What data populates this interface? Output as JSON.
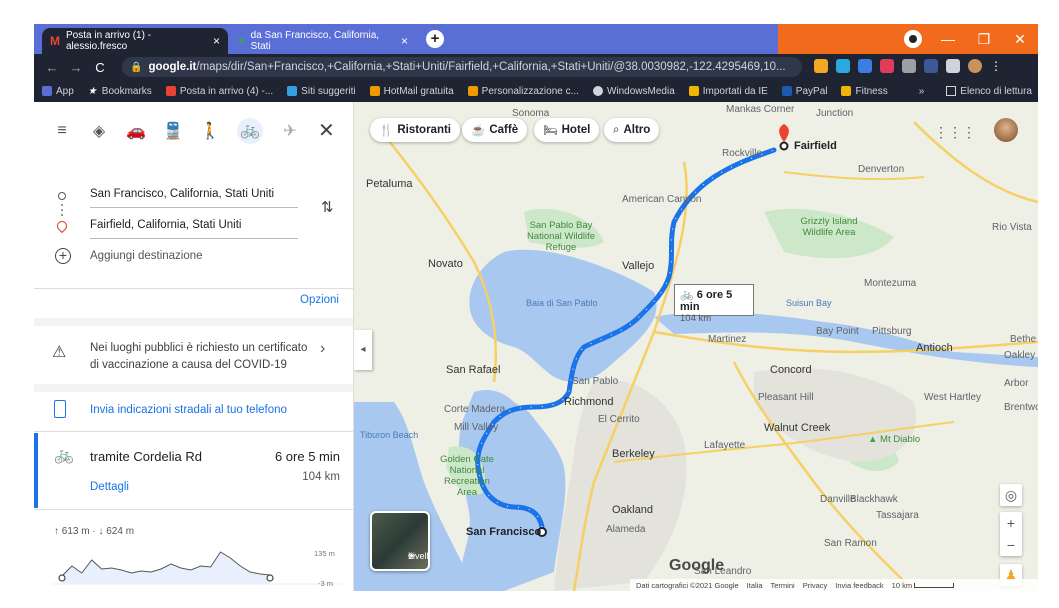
{
  "browser": {
    "tabs": [
      {
        "title": "Posta in arrivo (1) - alessio.fresco",
        "icon": "gmail-icon"
      },
      {
        "title": "da San Francisco, California, Stati",
        "icon": "maps-icon"
      }
    ],
    "tab_close": "×",
    "new_tab": "+",
    "window_controls": {
      "minimize": "—",
      "restore": "❐",
      "close": "✕"
    },
    "url_domain": "google.it",
    "url_path": "/maps/dir/San+Francisco,+California,+Stati+Uniti/Fairfield,+California,+Stati+Uniti/@38.0030982,-122.4295469,10...",
    "nav": {
      "back": "←",
      "forward": "→",
      "reload": "C"
    }
  },
  "bookmarks": {
    "items": [
      {
        "label": "App",
        "color": "#5a6fd6"
      },
      {
        "label": "Bookmarks",
        "color": "#ffffff"
      },
      {
        "label": "Posta in arrivo (4) -...",
        "color": "#ea4335"
      },
      {
        "label": "Siti suggeriti",
        "color": "#34a0e0"
      },
      {
        "label": "HotMail gratuita",
        "color": "#f29900"
      },
      {
        "label": "Personalizzazione c...",
        "color": "#f29900"
      },
      {
        "label": "WindowsMedia",
        "color": "#cfd3dc"
      },
      {
        "label": "Importati da IE",
        "color": "#f2b600"
      },
      {
        "label": "PayPal",
        "color": "#1a5ab0"
      },
      {
        "label": "Fitness",
        "color": "#f2b600"
      }
    ],
    "more": "»",
    "reading_list": "Elenco di lettura"
  },
  "panel": {
    "origin": "San Francisco, California, Stati Uniti",
    "destination": "Fairfield, California, Stati Uniti",
    "add_destination": "Aggiungi destinazione",
    "options": "Opzioni",
    "covid_notice": "Nei luoghi pubblici è richiesto un certificato di vaccinazione a causa del COVID-19",
    "send_to_phone": "Invia indicazioni stradali al tuo telefono",
    "route": {
      "via": "tramite Cordelia Rd",
      "duration": "6 ore 5 min",
      "distance": "104 km",
      "details": "Dettagli"
    },
    "elevation": {
      "summary": "↑ 613 m · ↓ 624 m",
      "max_label": "135 m",
      "min_label": "-3 m",
      "profile": [
        2,
        12,
        5,
        18,
        9,
        10,
        8,
        5,
        7,
        6,
        9,
        14,
        10,
        8,
        12,
        11,
        26,
        20,
        12,
        6,
        4,
        3
      ]
    }
  },
  "map": {
    "chips": [
      {
        "icon": "🍴",
        "label": "Ristoranti"
      },
      {
        "icon": "☕",
        "label": "Caffè"
      },
      {
        "icon": "🛏",
        "label": "Hotel"
      },
      {
        "icon": "⌕",
        "label": "Altro"
      }
    ],
    "route_box": {
      "time": "6 ore 5 min",
      "distance": "104 km"
    },
    "start_label": "San Francisco",
    "end_label": "Fairfield",
    "layers": "Livelli",
    "google_logo": "Google",
    "attribution": [
      "Dati cartografici ©2021 Google",
      "Italia",
      "Termini",
      "Privacy",
      "Invia feedback",
      "10 km"
    ],
    "cities": {
      "petaluma": "Petaluma",
      "novato": "Novato",
      "vallejo": "Vallejo",
      "american_canyon": "American Canyon",
      "san_rafael": "San Rafael",
      "corte_madera": "Corte Madera",
      "mill_valley": "Mill Valley",
      "richmond": "Richmond",
      "san_pablo": "San Pablo",
      "el_cerrito": "El Cerrito",
      "berkeley": "Berkeley",
      "oakland": "Oakland",
      "alameda": "Alameda",
      "san_leandro": "San Leandro",
      "concord": "Concord",
      "martinez": "Martinez",
      "walnut_creek": "Walnut Creek",
      "lafayette": "Lafayette",
      "danville": "Danville",
      "pleasant_hill": "Pleasant Hill",
      "antioch": "Antioch",
      "pittsburg": "Pittsburg",
      "bay_point": "Bay Point",
      "oakley": "Oakley",
      "brentwood": "Brentwood",
      "west_hartley": "West Hartley",
      "arbor": "Arbor",
      "montezuma": "Montezuma",
      "rio_vista": "Rio Vista",
      "denverton": "Denverton",
      "rockville": "Rockville",
      "tassajara": "Tassajara",
      "blackhawk": "Blackhawk",
      "san_ramon": "San Ramon",
      "sonoma": "Sonoma",
      "markham": "Mankas Corner",
      "junction": "Junction",
      "bethel": "Bethe",
      "mt_diablo": "Mt Diablo"
    },
    "water": {
      "baia": "Baia di San Pablo",
      "suisun": "Suisun Bay",
      "tiburon": "Tiburon Beach"
    },
    "parks": {
      "san_pablo_refuge": "San Pablo Bay National Wildlife Refuge",
      "grizzly": "Grizzly Island Wildlife Area",
      "golden_gate": "Golden Gate National Recreation Area"
    }
  }
}
